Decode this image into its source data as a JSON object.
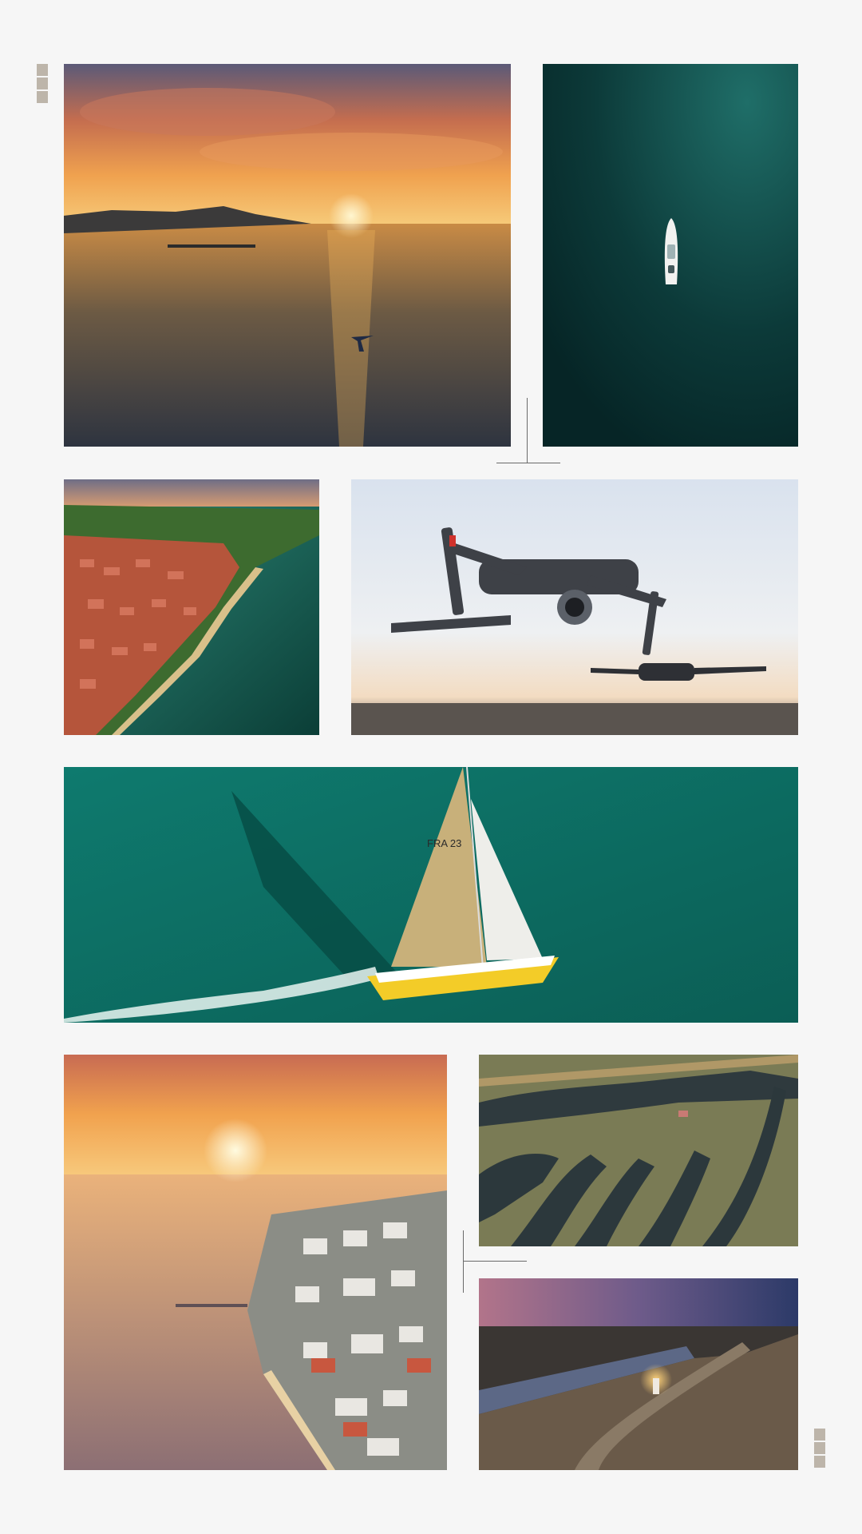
{
  "gallery": {
    "photos": [
      {
        "name": "sunset-pier-wakefoil-photo"
      },
      {
        "name": "boat-deep-sea-photo"
      },
      {
        "name": "coastal-village-aerial-photo"
      },
      {
        "name": "drone-flight-photo"
      },
      {
        "name": "sailboat-fra-photo",
        "sail_text": "FRA 23"
      },
      {
        "name": "sunset-town-aerial-photo"
      },
      {
        "name": "salt-marsh-aerial-photo"
      },
      {
        "name": "harbor-lighthouse-dusk-photo"
      }
    ],
    "colors": {
      "background": "#f6f6f6",
      "accent_marker": "#bdb5aa",
      "divider": "#6a6a6a"
    }
  }
}
